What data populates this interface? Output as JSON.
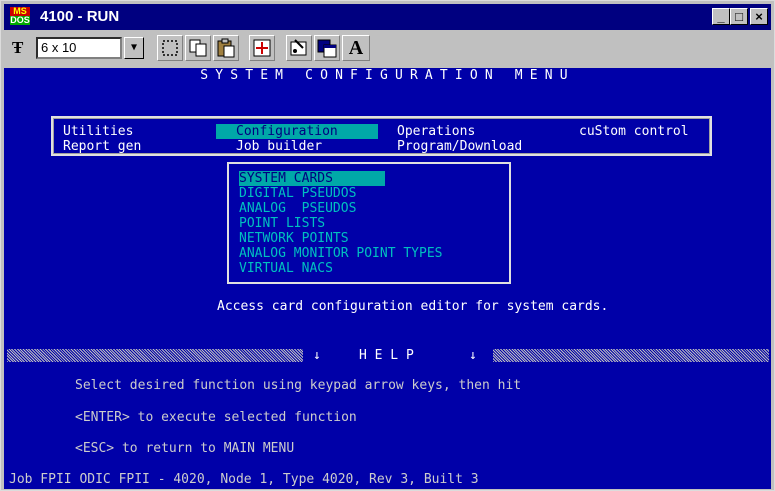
{
  "window": {
    "title": "4100 - RUN",
    "icon_top": "MS",
    "icon_bottom": "DOS",
    "minimize": "_",
    "maximize": "□",
    "close": "×"
  },
  "toolbar": {
    "font_size": "6 x 10",
    "font_glyph": "Ŧ",
    "a_label": "A",
    "icons": [
      "mark-icon",
      "copy-icon",
      "paste-icon",
      "fullscreen-icon",
      "properties-icon",
      "background-icon",
      "font-icon"
    ]
  },
  "screen": {
    "header": "SYSTEM CONFIGURATION MENU",
    "menu": {
      "utilities": "Utilities",
      "configuration": "Configuration",
      "operations": "Operations",
      "custom_control": "cuStom control",
      "report_gen": "Report gen",
      "job_builder": "Job builder",
      "program_download": "Program/Download"
    },
    "submenu": [
      "SYSTEM CARDS",
      "DIGITAL PSEUDOS",
      "ANALOG  PSEUDOS",
      "POINT LISTS",
      "NETWORK POINTS",
      "ANALOG MONITOR POINT TYPES",
      "VIRTUAL NACS"
    ],
    "description": "Access card configuration editor for system cards.",
    "help": {
      "arrow_left": "↓",
      "title": "H E L P",
      "arrow_right": "↓",
      "line1": "Select desired function using keypad arrow keys, then hit",
      "line2": "<ENTER> to execute selected function",
      "line3": "<ESC> to return to MAIN MENU"
    },
    "status": "Job FPII ODIC FPII - 4020, Node 1, Type 4020, Rev 3, Built 3"
  },
  "colors": {
    "screen_bg": "#0000a8",
    "highlight": "#00a8a8",
    "submenu_text": "#00c0c0",
    "titlebar": "#000080"
  }
}
